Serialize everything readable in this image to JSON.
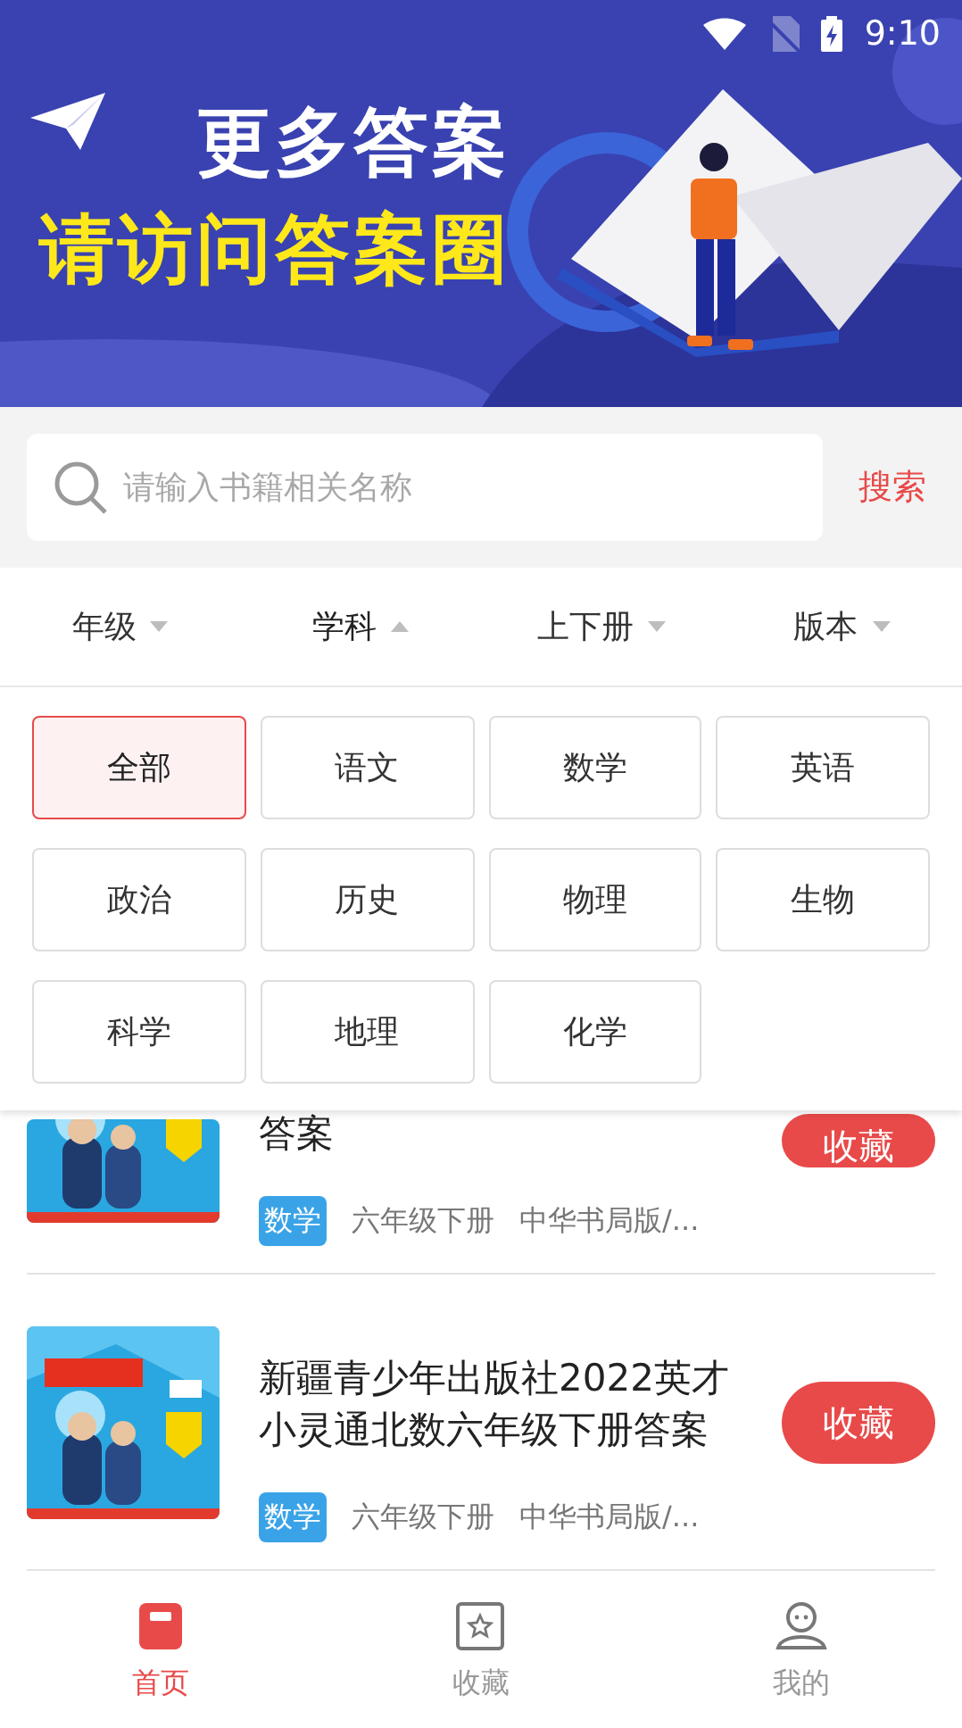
{
  "status_bar": {
    "time": "9:10"
  },
  "banner": {
    "line_1": "更多答案",
    "line_2": "请访问答案圈"
  },
  "search": {
    "placeholder": "请输入书籍相关名称",
    "button": "搜索"
  },
  "filters": [
    {
      "label": "年级",
      "expanded": false
    },
    {
      "label": "学科",
      "expanded": true
    },
    {
      "label": "上下册",
      "expanded": false
    },
    {
      "label": "版本",
      "expanded": false
    }
  ],
  "subject_options": [
    {
      "label": "全部",
      "selected": true
    },
    {
      "label": "语文",
      "selected": false
    },
    {
      "label": "数学",
      "selected": false
    },
    {
      "label": "英语",
      "selected": false
    },
    {
      "label": "政治",
      "selected": false
    },
    {
      "label": "历史",
      "selected": false
    },
    {
      "label": "物理",
      "selected": false
    },
    {
      "label": "生物",
      "selected": false
    },
    {
      "label": "科学",
      "selected": false
    },
    {
      "label": "地理",
      "selected": false
    },
    {
      "label": "化学",
      "selected": false
    }
  ],
  "books": [
    {
      "title": "答案",
      "subject": "数学",
      "grade": "六年级下册",
      "edition": "中华书局版/...",
      "button": "收藏"
    },
    {
      "title": "新疆青少年出版社2022英才小灵通北数六年级下册答案",
      "subject": "数学",
      "grade": "六年级下册",
      "edition": "中华书局版/...",
      "button": "收藏"
    }
  ],
  "tab_bar": [
    {
      "label": "首页",
      "kind": "home",
      "selected": true
    },
    {
      "label": "收藏",
      "kind": "favorites",
      "selected": false
    },
    {
      "label": "我的",
      "kind": "profile",
      "selected": false
    }
  ]
}
